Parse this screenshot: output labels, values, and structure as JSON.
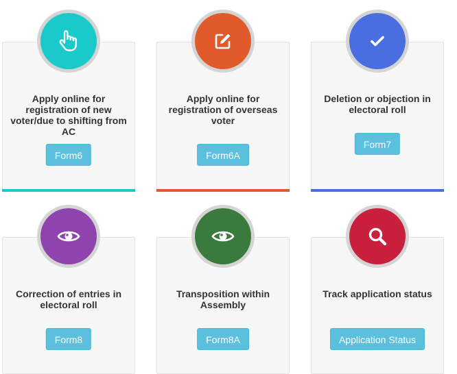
{
  "cards": [
    {
      "title": "Apply online for registration of new voter/due to shifting from AC",
      "button": "Form6",
      "icon": "hand-pointer-icon",
      "color": "#1ac9c9"
    },
    {
      "title": "Apply online for registration of overseas voter",
      "button": "Form6A",
      "icon": "edit-icon",
      "color": "#e05a2b"
    },
    {
      "title": "Deletion or objection in electoral roll",
      "button": "Form7",
      "icon": "check-icon",
      "color": "#4a6ee0"
    },
    {
      "title": "Correction of entries in electoral roll",
      "button": "Form8",
      "icon": "eye-icon",
      "color": "#8f44ad"
    },
    {
      "title": "Transposition within Assembly",
      "button": "Form8A",
      "icon": "eye-icon",
      "color": "#3a7a3c"
    },
    {
      "title": "Track application status",
      "button": "Application Status",
      "icon": "search-icon",
      "color": "#c8203d"
    }
  ]
}
